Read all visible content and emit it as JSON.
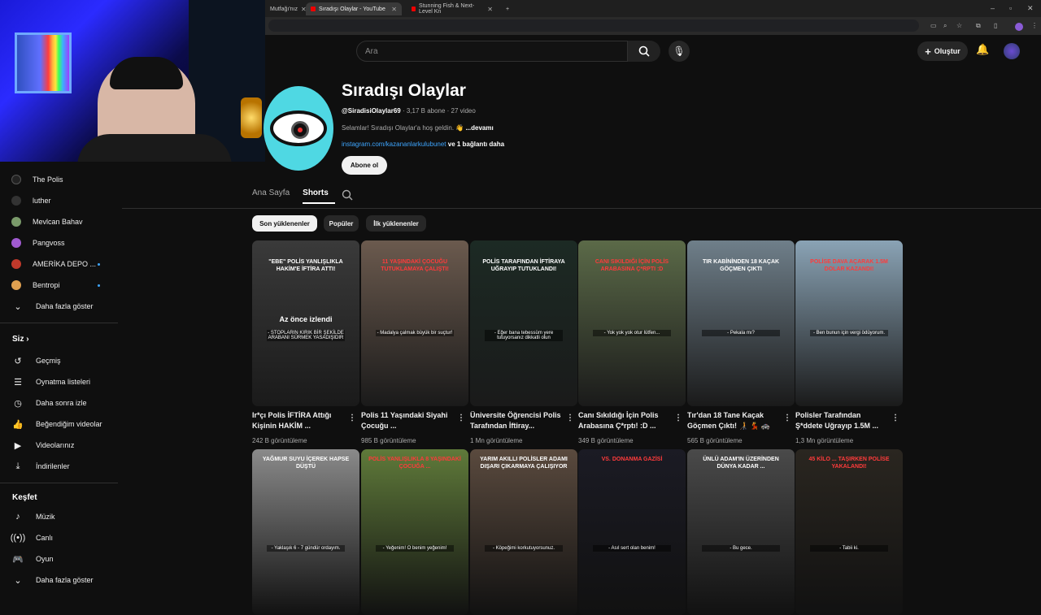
{
  "browser": {
    "tabs": [
      {
        "label": "Mutfağı'nız",
        "active": false
      },
      {
        "label": "Sıradışı Olaylar - YouTube",
        "active": true
      },
      {
        "label": "Stunning Fish & Next-Level Kn",
        "active": false
      }
    ]
  },
  "header": {
    "search_placeholder": "Ara",
    "create_label": "Oluştur"
  },
  "sidebar": {
    "subscriptions": [
      {
        "label": "The Polis",
        "dot": false
      },
      {
        "label": "luther",
        "dot": false
      },
      {
        "label": "Mevlcan Bahav",
        "dot": false
      },
      {
        "label": "Pangvoss",
        "dot": false
      },
      {
        "label": "AMERİKA DEPO ...",
        "dot": true
      },
      {
        "label": "Bentropi",
        "dot": true
      }
    ],
    "show_more_1": "Daha fazla göster",
    "you_heading": "Siz",
    "you_items": [
      "Geçmiş",
      "Oynatma listeleri",
      "Daha sonra izle",
      "Beğendiğim videolar",
      "Videolarınız",
      "İndirilenler"
    ],
    "explore_heading": "Keşfet",
    "explore_items": [
      "Müzik",
      "Canlı",
      "Oyun"
    ],
    "show_more_2": "Daha fazla göster"
  },
  "channel": {
    "title": "Sıradışı Olaylar",
    "handle": "@SiradisiOlaylar69",
    "stats": " · 3,17 B abone · 27 video",
    "description": "Selamlar! Sıradışı Olaylar'a hoş geldin. 👋",
    "more": "...devamı",
    "link": "instagram.com/kazananlarkulubunet",
    "link_more": " ve 1 bağlantı daha",
    "subscribe_label": "Abone ol",
    "tabs": [
      "Ana Sayfa",
      "Shorts"
    ],
    "chips": [
      "Son yüklenenler",
      "Popüler",
      "İlk yüklenenler"
    ]
  },
  "shorts_row1": [
    {
      "caption": "\"EBE\" POLİS YANLIŞLIKLA HAKİM'E İFTİRA ATTI!",
      "sub": "- STOPLARIN KIRIK BİR ŞEKİLDE ARABANI SÜRMEK YASADIŞIDIR",
      "title": "Ir*çı Polis İFTİRA Attığı Kişinin HAKİM ...",
      "views": "242 B görüntüleme",
      "watched": "Az önce izlendi",
      "color": "#3a3a3a"
    },
    {
      "caption": "11 YAŞINDAKİ ÇOCUĞU TUTUKLAMAYA ÇALIŞTI!",
      "sub": "- Madalya çalmak büyük bir suçtur!",
      "title": "Polis 11 Yaşındaki Siyahi Çocuğu ...",
      "views": "985 B görüntüleme",
      "color": "#6b5a4e"
    },
    {
      "caption": "POLİS TARAFINDAN İFTİRAYA UĞRAYIP TUTUKLANDI!",
      "sub": "- Eğer bana tebessüm yere tutuyorsanız dikkatli olun",
      "title": "Üniversite Öğrencisi Polis Tarafından İftiray...",
      "views": "1 Mn görüntüleme",
      "color": "#1c2a24"
    },
    {
      "caption": "CANI SIKILDIĞI İÇİN POLİS ARABASINA Ç*RPTI :D",
      "sub": "- Yok yok yok otur lütfen...",
      "title": "Canı Sıkıldığı İçin Polis Arabasına Ç*rptı! :D ...",
      "views": "349 B görüntüleme",
      "color": "#5b6a48"
    },
    {
      "caption": "TIR KABİNİNDEN 18 KAÇAK GÖÇMEN ÇIKTI",
      "sub": "- Pekala mı?",
      "title": "Tır'dan 18 Tane Kaçak Göçmen Çıktı! 🧑‍🦯 💃 🚓",
      "views": "565 B görüntüleme",
      "color": "#6f7f8a"
    },
    {
      "caption": "POLİSE DAVA AÇARAK 1.5M DOLAR KAZANDI!",
      "sub": "- Ben bunun için vergi ödüyorum.",
      "title": "Polisler Tarafından Ş*ddete Uğrayıp 1.5M ...",
      "views": "1,3 Mn görüntüleme",
      "color": "#8aa3b5"
    }
  ],
  "shorts_row2": [
    {
      "caption": "YAĞMUR SUYU İÇEREK HAPSE DÜŞTÜ",
      "sub": "- Yaklaşık 6 - 7 gündür ordayım.",
      "color": "#8a8a8a"
    },
    {
      "caption": "POLİS YANLIŞLIKLA 8 YAŞINDAKİ ÇOCUĞA ...",
      "sub": "- Yeğenim! O benim yeğenim!",
      "color": "#5f7a3a"
    },
    {
      "caption": "YARIM AKILLI POLİSLER ADAMI DIŞARI ÇIKARMAYA ÇALIŞIYOR",
      "sub": "- Köpeğimi korkutuyorsunuz.",
      "color": "#5a4a3e"
    },
    {
      "caption": "VS. DONANMA GAZİSİ",
      "sub": "- Asıl sert olan benim!",
      "color": "#1b1b24"
    },
    {
      "caption": "ÜNLÜ ADAM'IN ÜZERİNDEN DÜNYA KADAR ...",
      "sub": "- Bu gece.",
      "color": "#4a4a4a"
    },
    {
      "caption": "45 KİLO ... TAŞIRKEN POLİSE YAKALANDI!",
      "sub": "- Tabii ki.",
      "color": "#2a2620"
    }
  ]
}
